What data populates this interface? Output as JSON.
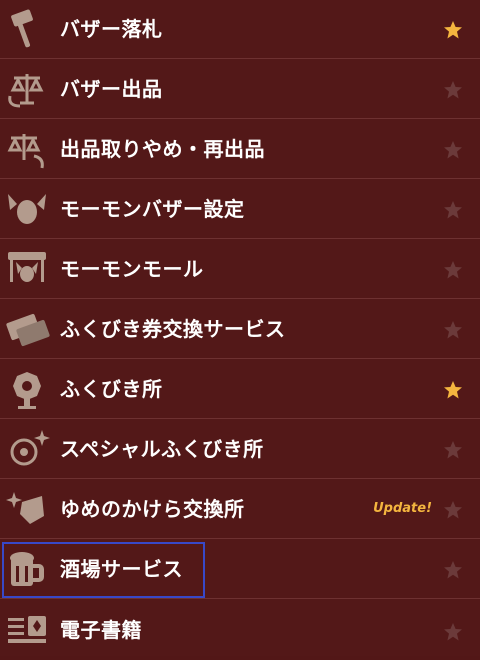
{
  "menu": {
    "items": [
      {
        "label": "バザー落札",
        "icon": "gavel-icon",
        "favorite": true
      },
      {
        "label": "バザー出品",
        "icon": "scale-arrow-icon",
        "favorite": false
      },
      {
        "label": "出品取りやめ・再出品",
        "icon": "scale-return-icon",
        "favorite": false
      },
      {
        "label": "モーモンバザー設定",
        "icon": "momon-icon",
        "favorite": false
      },
      {
        "label": "モーモンモール",
        "icon": "shop-icon",
        "favorite": false
      },
      {
        "label": "ふくびき券交換サービス",
        "icon": "ticket-exchange-icon",
        "favorite": false
      },
      {
        "label": "ふくびき所",
        "icon": "lottery-wheel-icon",
        "favorite": true
      },
      {
        "label": "スペシャルふくびき所",
        "icon": "special-lottery-icon",
        "favorite": false
      },
      {
        "label": "ゆめのかけら交換所",
        "icon": "dream-fragment-icon",
        "favorite": false,
        "badge": "Update!"
      },
      {
        "label": "酒場サービス",
        "icon": "beer-mug-icon",
        "favorite": false
      },
      {
        "label": "電子書籍",
        "icon": "ebook-icon",
        "favorite": false
      }
    ]
  },
  "colors": {
    "background": "#531818",
    "divider": "#6e3131",
    "icon": "#b39b8d",
    "star_on": "#f4b53f",
    "star_off": "#6b3a3a",
    "highlight": "#3848c8",
    "badge": "#f4b53f"
  }
}
